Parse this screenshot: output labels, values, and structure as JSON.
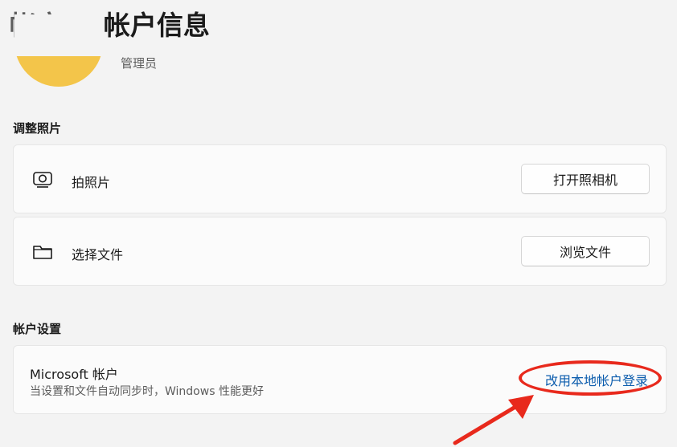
{
  "breadcrumb": {
    "parent": "帐户",
    "separator": "›",
    "current": "帐户信息"
  },
  "profile": {
    "role": "管理员"
  },
  "adjust_photo": {
    "title": "调整照片",
    "rows": [
      {
        "icon": "camera-icon",
        "label": "拍照片",
        "button": "打开照相机"
      },
      {
        "icon": "folder-icon",
        "label": "选择文件",
        "button": "浏览文件"
      }
    ]
  },
  "account_settings": {
    "title": "帐户设置",
    "microsoft_account": {
      "title": "Microsoft 帐户",
      "subtitle": "当设置和文件自动同步时，Windows 性能更好",
      "link": "改用本地帐户登录"
    }
  },
  "colors": {
    "accent_link": "#0b5cad",
    "annotation_red": "#e8291c",
    "avatar_yellow": "#f3c54a"
  }
}
